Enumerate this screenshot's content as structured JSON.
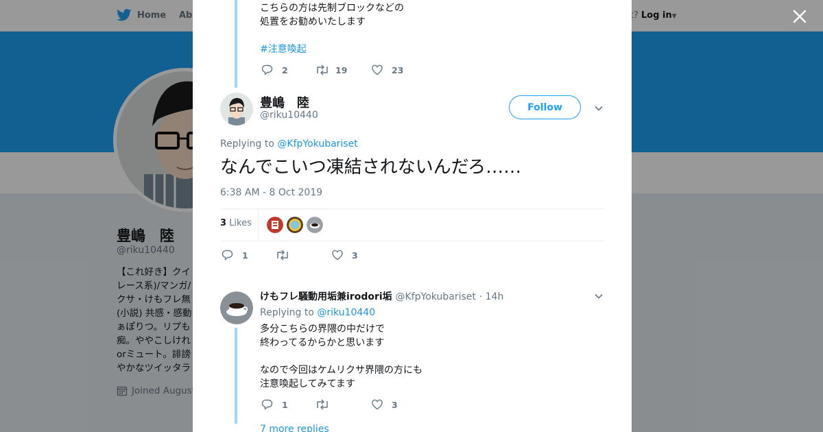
{
  "nav": {
    "home_label": "Home",
    "about_label": "Abo",
    "account_prompt": "ccount?",
    "login_label": "Log in"
  },
  "profile": {
    "name": "豊嶋　陸",
    "handle": "@riku10440",
    "bio": "【これ好き】クイ\nレース系)/マンガ/\nクサ・けもフレ無\n(小説) 共感・感動\nぁぽりつ。リプも\n痴。ややこしけれ\norミュート。誹謗\nやかなツイッタラ",
    "joined": "Joined August"
  },
  "prev_tweet": {
    "lines": [
      "こちらの方は先制ブロックなどの",
      "処置をお勧めいたします"
    ],
    "hashtag": "#注意喚起",
    "replies": "2",
    "retweets": "19",
    "likes": "23"
  },
  "main_tweet": {
    "name": "豊嶋　陸",
    "handle": "@riku10440",
    "follow_label": "Follow",
    "replying_prefix": "Replying to",
    "replying_to": "@KfpYokubariset",
    "text": "なんでこいつ凍結されないんだろ……",
    "timestamp": "6:38 AM - 8 Oct 2019",
    "likes_count": "3",
    "likes_label": "Likes",
    "reply_count": "1",
    "like_count_action": "3"
  },
  "reply_tweet": {
    "name": "けもフレ騒動用垢兼irodori垢",
    "handle": "@KfpYokubariset",
    "time": "· 14h",
    "replying_prefix": "Replying to",
    "replying_to": "@riku10440",
    "lines": [
      "多分こちらの界隈の中だけで",
      "終わってるからかと思います",
      "なので今回はケムリクサ界隈の方にも",
      "注意喚起してみてます"
    ],
    "replies": "1",
    "likes": "3",
    "more_replies": "7 more replies"
  },
  "colors": {
    "accent": "#1da1f2",
    "link": "#1b95e0",
    "thread_line": "#9fd8f6",
    "muted": "#657786"
  }
}
